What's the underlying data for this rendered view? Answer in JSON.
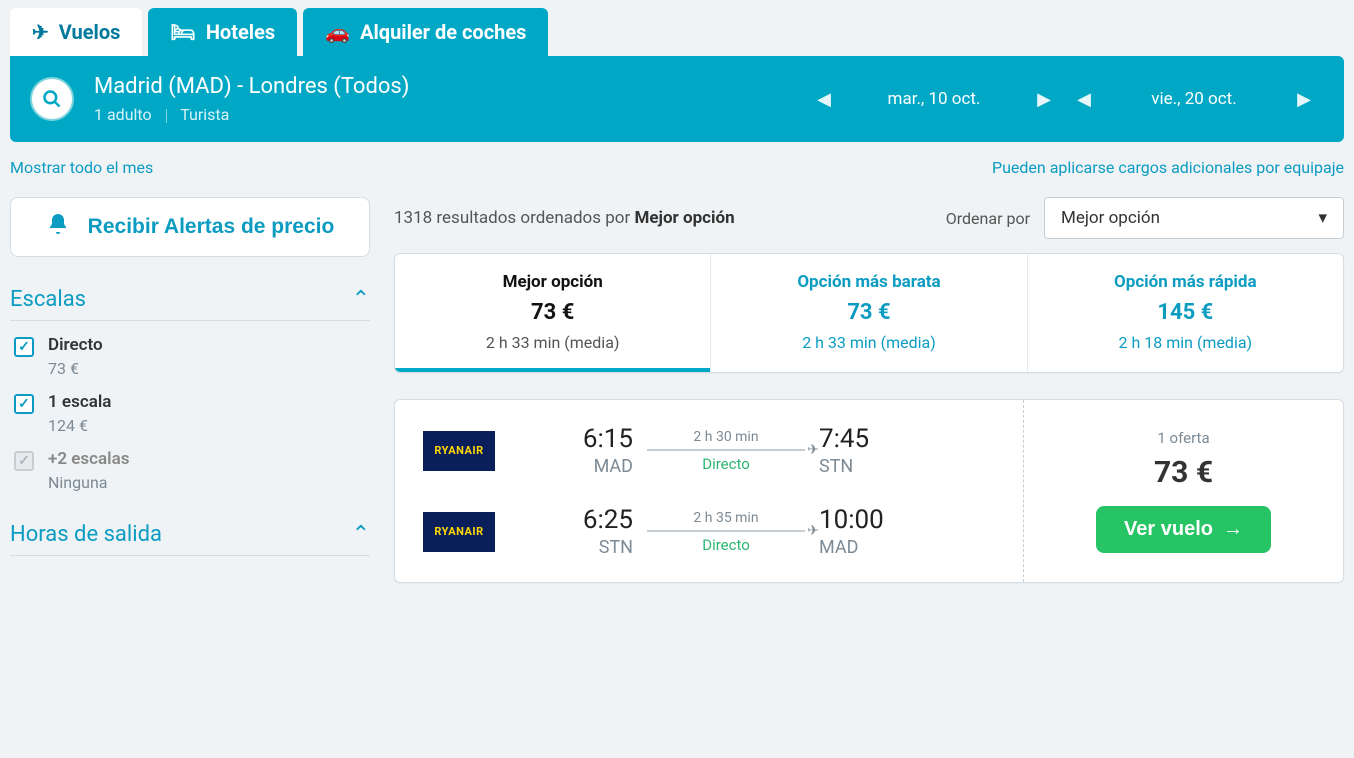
{
  "tabs": {
    "flights": "Vuelos",
    "hotels": "Hoteles",
    "cars": "Alquiler de coches"
  },
  "search": {
    "route": "Madrid (MAD) - Londres (Todos)",
    "pax": "1 adulto",
    "cabin": "Turista",
    "depart_date": "mar., 10 oct.",
    "return_date": "vie., 20 oct."
  },
  "links": {
    "show_month": "Mostrar todo el mes",
    "baggage": "Pueden aplicarse cargos adicionales por equipaje"
  },
  "alerts": {
    "button": "Recibir Alertas de precio"
  },
  "filters": {
    "stops_title": "Escalas",
    "departure_title": "Horas de salida",
    "stops": [
      {
        "label": "Directo",
        "sub": "73 €",
        "state": "checked"
      },
      {
        "label": "1 escala",
        "sub": "124 €",
        "state": "checked"
      },
      {
        "label": "+2 escalas",
        "sub": "Ninguna",
        "state": "disabled"
      }
    ]
  },
  "results": {
    "summary_prefix": "1318 resultados ordenados por ",
    "summary_sort": "Mejor opción",
    "sort_label": "Ordenar por",
    "sort_value": "Mejor opción"
  },
  "options": [
    {
      "title": "Mejor opción",
      "price": "73 €",
      "detail": "2 h 33 min (media)",
      "active": true
    },
    {
      "title": "Opción más barata",
      "price": "73 €",
      "detail": "2 h 33 min (media)",
      "active": false
    },
    {
      "title": "Opción más rápida",
      "price": "145 €",
      "detail": "2 h 18 min (media)",
      "active": false
    }
  ],
  "card": {
    "airline": "RYANAIR",
    "outbound": {
      "dep_time": "6:15",
      "dep_code": "MAD",
      "duration": "2 h 30 min",
      "type": "Directo",
      "arr_time": "7:45",
      "arr_code": "STN"
    },
    "inbound": {
      "dep_time": "6:25",
      "dep_code": "STN",
      "duration": "2 h 35 min",
      "type": "Directo",
      "arr_time": "10:00",
      "arr_code": "MAD"
    },
    "offers": "1 oferta",
    "price": "73 €",
    "cta": "Ver vuelo"
  }
}
